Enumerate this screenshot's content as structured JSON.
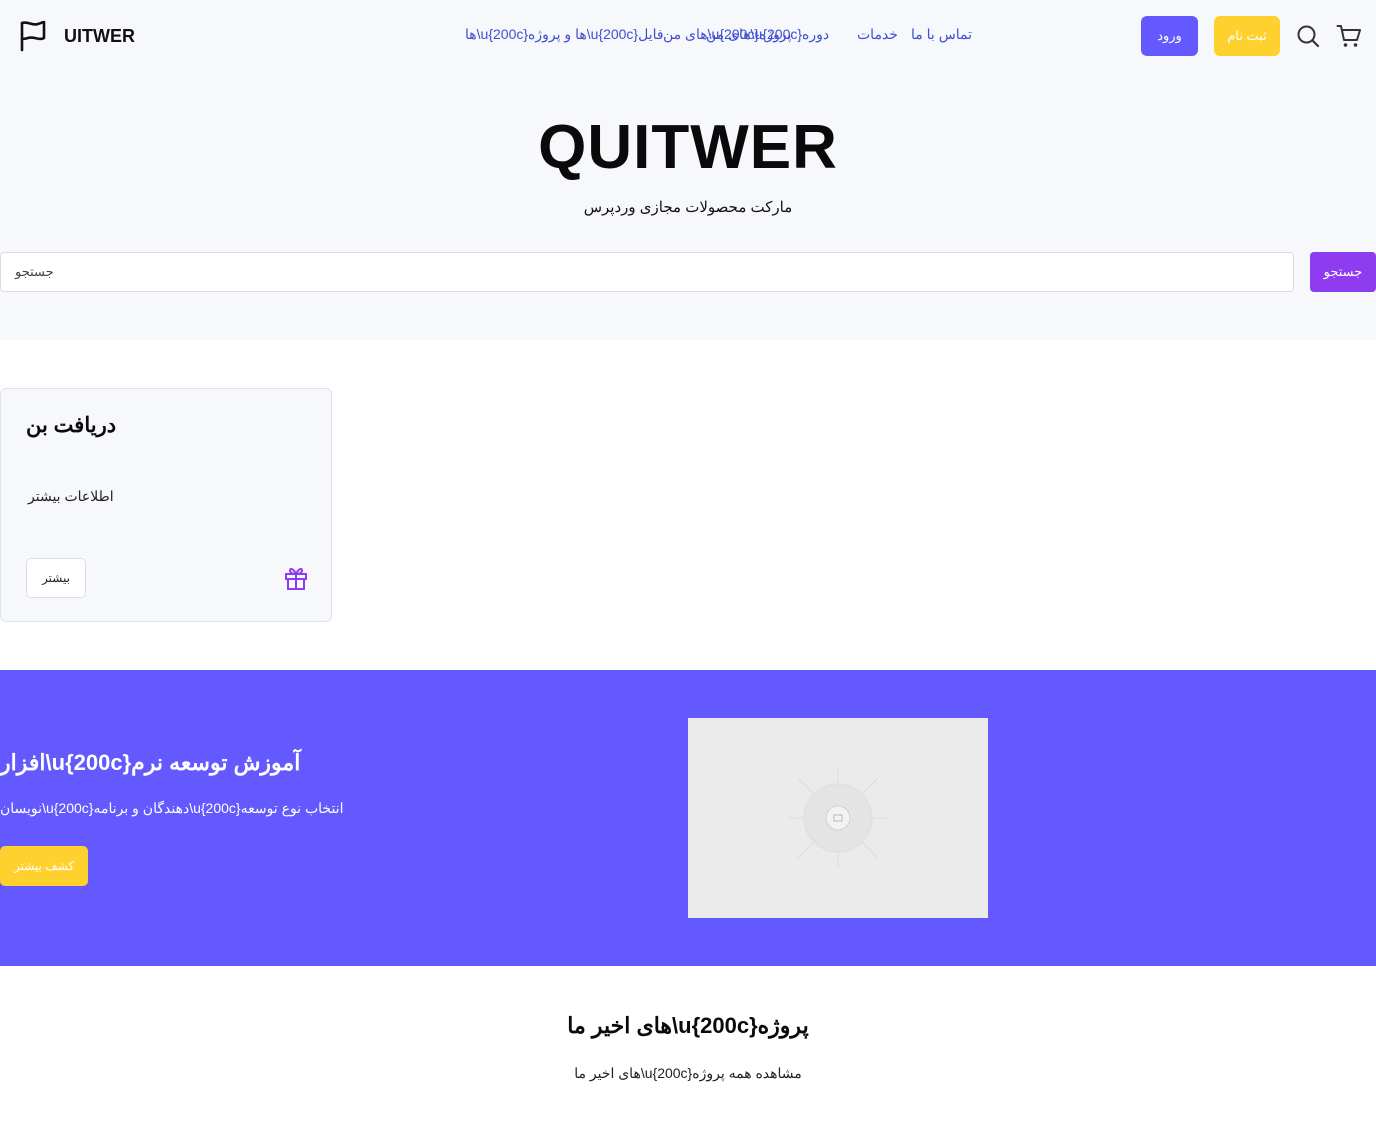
{
  "header": {
    "logo_text": "UITWER",
    "nav": [
      {
        "label": "تماس با ما"
      },
      {
        "label": "خدمات"
      },
      {
        "label": "های من\\u{200c}دوره"
      },
      {
        "label": "ها\\u{200c}ها و پروژه\\u{200c}فایل"
      },
      {
        "label": "های من\\u{200c}پروژه"
      }
    ],
    "login_label": "ورود",
    "signup_label": "ثبت نام"
  },
  "hero": {
    "title": "QUITWER",
    "subtitle": "مارکت محصولات مجازی وردپرس",
    "search_placeholder": "جستجو",
    "search_button": "جستجو"
  },
  "card": {
    "title": "دریافت بن",
    "text": "اطلاعات بیشتر",
    "button": "بیشتر"
  },
  "promo": {
    "title": "افزار\\u{200c}آموزش توسعه نرم",
    "text": "نویسان\\u{200c}دهندگان و برنامه\\u{200c}انتخاب نوع توسعه",
    "button": "کشف بیشتر"
  },
  "projects": {
    "title": "های اخیر ما\\u{200c}پروژه",
    "subtitle": "های اخیر ما\\u{200c}مشاهده همه پروژه"
  },
  "colors": {
    "primary": "#6359fe",
    "accent": "#ffd12e",
    "search_button": "#8f3cf0",
    "nav_link": "#3e4fd0",
    "hero_bg": "#f7f8fb"
  },
  "icons": [
    "flag-logo-icon",
    "search-icon",
    "cart-icon",
    "gift-icon",
    "image-placeholder-icon"
  ]
}
